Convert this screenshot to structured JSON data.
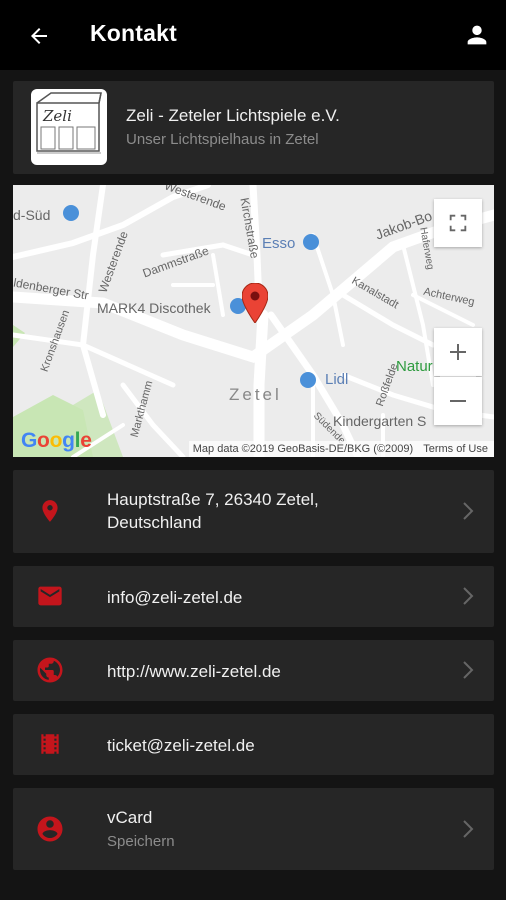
{
  "appbar": {
    "title": "Kontakt",
    "back_icon": "arrow-left-icon",
    "account_icon": "person-icon"
  },
  "header": {
    "logo_text": "Zeli",
    "name": "Zeli - Zeteler Lichtspiele e.V.",
    "subtitle": "Unser Lichtspielhaus in Zetel"
  },
  "map": {
    "labels": {
      "sued": "d-Süd",
      "westerende_top": "Westerende",
      "dammstrasse": "Dammstraße",
      "kirchstrasse": "Kirchstraße",
      "esso": "Esso",
      "jakob": "Jakob-Bo",
      "westerende_left": "Westerende",
      "oldenberger": "ldenberger Str",
      "kanalstadt": "Kanalstadt",
      "achterweg": "Achterweg",
      "mark4": "MARK4 Discothek",
      "kronshausen": "Kronshausen",
      "natur": "Natur",
      "lidl": "Lidl",
      "zetel": "Zetel",
      "rossfelde": "Roßfelde",
      "markthamm": "Markthamm",
      "kindergarten": "Kindergarten S",
      "suedende": "Südende",
      "haferweg": "Haferweg"
    },
    "attribution_data": "Map data ©2019 GeoBasis-DE/BKG (©2009)",
    "attribution_terms": "Terms of Use",
    "google": [
      "G",
      "o",
      "o",
      "g",
      "l",
      "e"
    ],
    "colors": {
      "road": "#ffffff",
      "bg": "#ececec",
      "pin": "#ea4335",
      "poi": "#4a90d9",
      "park": "#c8e6b4"
    }
  },
  "contacts": [
    {
      "icon": "location-pin-icon",
      "line1": "Hauptstraße 7, 26340 Zetel,",
      "line2": "Deutschland"
    },
    {
      "icon": "mail-icon",
      "text": "info@zeli-zetel.de"
    },
    {
      "icon": "globe-icon",
      "text": "http://www.zeli-zetel.de"
    },
    {
      "icon": "film-icon",
      "text": "ticket@zeli-zetel.de"
    },
    {
      "icon": "account-circle-icon",
      "text": "vCard",
      "sub": "Speichern"
    }
  ],
  "accent_color": "#c4151c"
}
